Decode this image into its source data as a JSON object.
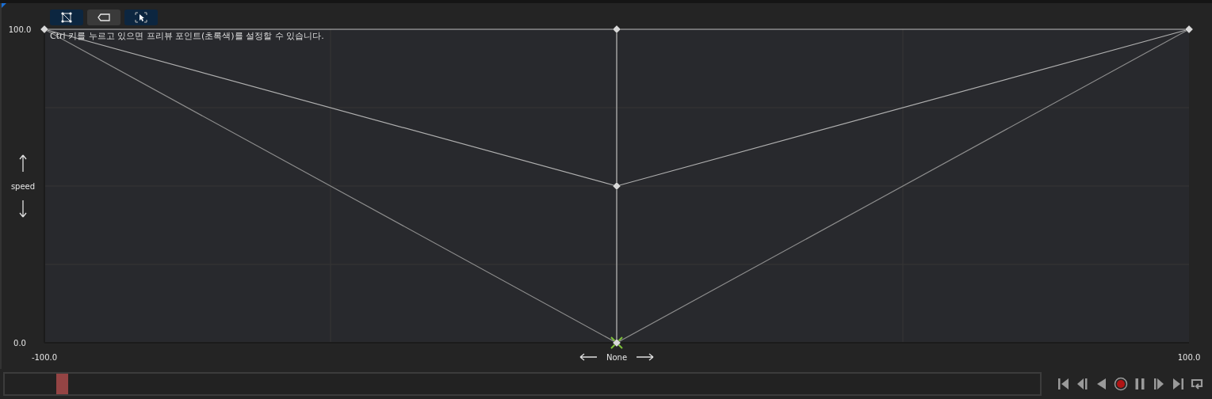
{
  "toolbar": [
    {
      "kind": "triangulate",
      "selected": true
    },
    {
      "kind": "label",
      "selected": false
    },
    {
      "kind": "select",
      "selected": true
    }
  ],
  "hint": "Ctrl 키를 누르고 있으면 프리뷰 포인트(초록색)를 설정할 수 있습니다.",
  "chart_data": {
    "type": "line",
    "xlabel": "None",
    "ylabel": "speed",
    "series": [
      {
        "color": "#bdbdbd",
        "marker": "diamond",
        "x": [
          -100,
          0,
          100
        ],
        "values": [
          100,
          100,
          100
        ]
      },
      {
        "color": "#b0b0b0",
        "x": [
          -100,
          0,
          100
        ],
        "values": [
          100,
          50,
          100
        ]
      },
      {
        "color": "#8d8d8d",
        "x": [
          -100,
          0,
          100
        ],
        "values": [
          100,
          0,
          100
        ]
      },
      {
        "color": "#bdbdbd",
        "x": [
          0,
          0,
          0
        ],
        "values": [
          100,
          50,
          0
        ]
      }
    ],
    "xlim": [
      -100,
      100
    ],
    "ylim": [
      0,
      100
    ],
    "xticks": [
      {
        "value": -100,
        "label": "-100.0"
      },
      {
        "value": 100,
        "label": "100.0"
      }
    ],
    "yticks": [
      {
        "value": 0,
        "label": "0.0"
      },
      {
        "value": 100,
        "label": "100.0"
      }
    ]
  },
  "preview_marker": {
    "shown": true
  },
  "scrubber": {
    "level": 0.05
  },
  "transport": [
    {
      "kind": "start"
    },
    {
      "kind": "back-frame"
    },
    {
      "kind": "reverse"
    },
    {
      "kind": "record"
    },
    {
      "kind": "pause"
    },
    {
      "kind": "forward-frame"
    },
    {
      "kind": "end"
    },
    {
      "kind": "loop"
    }
  ]
}
